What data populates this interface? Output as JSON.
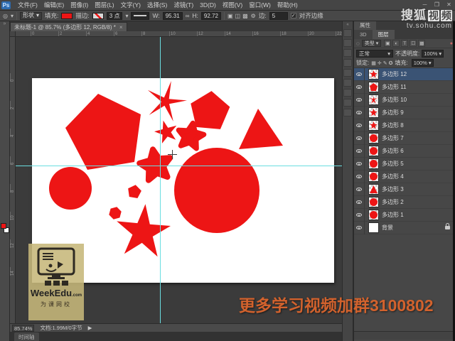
{
  "colors": {
    "shape_red": "#ed1515",
    "guide_cyan": "#6adde0",
    "caption_orange": "#d2622d",
    "selected_layer": "#3a5374"
  },
  "menu_bar": {
    "logo": "Ps",
    "items": [
      "文件(F)",
      "编辑(E)",
      "图像(I)",
      "图层(L)",
      "文字(Y)",
      "选择(S)",
      "滤镜(T)",
      "3D(D)",
      "视图(V)",
      "窗口(W)",
      "帮助(H)"
    ],
    "minimize": "─",
    "restore": "❐",
    "close": "✕"
  },
  "options_bar": {
    "tool_preset_icon": "◎",
    "tool_preset_arrow": "▾",
    "mode": "形状",
    "mode_arrow": "▾",
    "fill_label": "填充:",
    "stroke_label": "描边:",
    "stroke_width": "3 点",
    "stroke_width_arrow": "▾",
    "w_label": "W:",
    "w_value": "95.31",
    "link_icon": "∞",
    "h_label": "H:",
    "h_value": "92.72",
    "path_ops": [
      "▣",
      "◫",
      "▩"
    ],
    "gear_icon": "⚙",
    "sides_label": "边:",
    "sides_value": "5",
    "checkbox_check": "✓",
    "align_edges_label": "对齐边缘"
  },
  "toolbar": {
    "collapse_icon": "»",
    "tools": [
      {
        "name": "move-tool",
        "glyph": "▶"
      },
      {
        "name": "marquee-tool",
        "glyph": "☐"
      },
      {
        "name": "lasso-tool",
        "glyph": "✄"
      },
      {
        "name": "quick-selection-tool",
        "glyph": "✦"
      },
      {
        "name": "crop-tool",
        "glyph": "⌗"
      },
      {
        "name": "eyedropper-tool",
        "glyph": "✧"
      },
      {
        "name": "healing-brush-tool",
        "glyph": "✚"
      },
      {
        "name": "brush-tool",
        "glyph": "✎"
      },
      {
        "name": "clone-stamp-tool",
        "glyph": "◉"
      },
      {
        "name": "history-brush-tool",
        "glyph": "↺"
      },
      {
        "name": "eraser-tool",
        "glyph": "▭"
      },
      {
        "name": "gradient-tool",
        "glyph": "▦"
      },
      {
        "name": "blur-tool",
        "glyph": "○"
      },
      {
        "name": "dodge-tool",
        "glyph": "◐"
      },
      {
        "name": "pen-tool",
        "glyph": "✒"
      },
      {
        "name": "type-tool",
        "glyph": "T"
      },
      {
        "name": "path-selection-tool",
        "glyph": "▷"
      },
      {
        "name": "shape-tool",
        "glyph": "◇"
      },
      {
        "name": "hand-tool",
        "glyph": "❖"
      },
      {
        "name": "zoom-tool",
        "glyph": "◎"
      }
    ]
  },
  "document": {
    "tab_title": "未标题-1 @ 85.7% (多边形 12, RGB/8) *",
    "tab_close": "×",
    "ruler_top": [
      "0",
      "2",
      "4",
      "6",
      "8",
      "10",
      "12",
      "14",
      "16",
      "18",
      "20",
      "22"
    ],
    "ruler_left": [
      "0",
      "2",
      "4",
      "6",
      "8",
      "10",
      "12",
      "14"
    ]
  },
  "status_bar": {
    "zoom": "85.74%",
    "doc_info": "文档:1.99M/0字节",
    "expand_icon": "▶",
    "timeline_tab": "时间轴"
  },
  "dock": {
    "collapse_icon": "«",
    "icons": [
      {
        "name": "history-panel-icon",
        "glyph": "↺"
      },
      {
        "name": "swatches-panel-icon",
        "glyph": "▤"
      },
      {
        "name": "color-panel-icon",
        "glyph": "▦"
      },
      {
        "name": "adjustments-panel-icon",
        "glyph": "◧"
      },
      {
        "name": "styles-panel-icon",
        "glyph": "▧"
      },
      {
        "name": "character-panel-icon",
        "glyph": "A"
      },
      {
        "name": "paragraph-panel-icon",
        "glyph": "¶"
      },
      {
        "name": "info-panel-icon",
        "glyph": "☰"
      },
      {
        "name": "brush-panel-icon",
        "glyph": "✎"
      }
    ]
  },
  "layers_panel": {
    "tab_properties": "属性",
    "tab_3d": "3D",
    "tab_layers": "图层",
    "search_icon": "◌",
    "filter_kind": "类型",
    "filter_arrow": "▾",
    "filter_icons": [
      "▣",
      "◐",
      "T",
      "☐",
      "▩"
    ],
    "filter_toggle_icon": "●",
    "blend_mode": "正常",
    "blend_arrow": "▾",
    "opacity_label": "不透明度:",
    "opacity_value": "100%",
    "opacity_arrow": "▾",
    "lock_label": "锁定:",
    "lock_icons": [
      "▦",
      "✛",
      "✎",
      "✪"
    ],
    "fill_label": "填充:",
    "fill_value": "100%",
    "fill_arrow": "▾",
    "layers": [
      {
        "name": "多边形 12",
        "shape": "star",
        "selected": true
      },
      {
        "name": "多边形 11",
        "shape": "pentagon"
      },
      {
        "name": "多边形 10",
        "shape": "thinstar"
      },
      {
        "name": "多边形 9",
        "shape": "star"
      },
      {
        "name": "多边形 8",
        "shape": "star"
      },
      {
        "name": "多边形 7",
        "shape": "circle"
      },
      {
        "name": "多边形 6",
        "shape": "circle"
      },
      {
        "name": "多边形 5",
        "shape": "circle"
      },
      {
        "name": "多边形 4",
        "shape": "circle"
      },
      {
        "name": "多边形 3",
        "shape": "triangle"
      },
      {
        "name": "多边形 2",
        "shape": "circle"
      },
      {
        "name": "多边形 1",
        "shape": "circle"
      },
      {
        "name": "背景",
        "shape": "bg",
        "bg": true,
        "locked": true
      }
    ],
    "bottom_icons": [
      {
        "name": "link-layers-icon",
        "glyph": "∞"
      },
      {
        "name": "layer-effects-icon",
        "glyph": "fx"
      },
      {
        "name": "layer-mask-icon",
        "glyph": "▣"
      },
      {
        "name": "adjustment-layer-icon",
        "glyph": "◐"
      },
      {
        "name": "layer-group-icon",
        "glyph": "❐"
      },
      {
        "name": "new-layer-icon",
        "glyph": "⊞"
      },
      {
        "name": "delete-layer-icon",
        "glyph": "▯"
      }
    ]
  },
  "canvas": {
    "shapes": [
      {
        "name": "pentagon-large",
        "color": "#ed1515"
      },
      {
        "name": "star-thin",
        "color": "#ed1515"
      },
      {
        "name": "star-small",
        "color": "#ed1515"
      },
      {
        "name": "star-rounded",
        "color": "#ed1515"
      },
      {
        "name": "pentagon-top-right",
        "color": "#ed1515"
      },
      {
        "name": "triangle",
        "color": "#ed1515"
      },
      {
        "name": "star-bumpy",
        "color": "#ed1515"
      },
      {
        "name": "circle-large",
        "color": "#ed1515"
      },
      {
        "name": "circle-left",
        "color": "#ed1515"
      },
      {
        "name": "pentagon-tiny",
        "color": "#ed1515"
      },
      {
        "name": "hexagon-tiny",
        "color": "#ed1515"
      },
      {
        "name": "star-large",
        "color": "#ed1515"
      }
    ]
  },
  "watermarks": {
    "sohu_part1": "搜狐",
    "sohu_part2": [
      "视",
      "频"
    ],
    "sohu_url": "tv.sohu.com",
    "weekedu_name": "WeekEdu",
    "weekedu_tld": ".com",
    "weekedu_cn": "为课网校",
    "bottom_caption": "更多学习视频加群3100802"
  }
}
